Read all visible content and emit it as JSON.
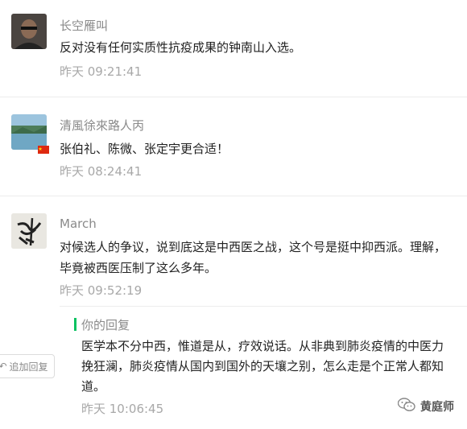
{
  "comments": [
    {
      "nickname": "长空雁叫",
      "content": "反对没有任何实质性抗疫成果的钟南山入选。",
      "time": "昨天 09:21:41",
      "avatar_icon": "bald-man-avatar"
    },
    {
      "nickname": "清風徐來路人丙",
      "content": "张伯礼、陈微、张定宇更合适！",
      "time": "昨天 08:24:41",
      "avatar_icon": "lake-landscape-avatar",
      "flag_icon": "china-flag-icon"
    },
    {
      "nickname": "March",
      "content": "对候选人的争议，说到底这是中西医之战，这个号是挺中抑西派。理解，毕竟被西医压制了这么多年。",
      "time": "昨天 09:52:19",
      "avatar_icon": "calligraphy-avatar"
    }
  ],
  "reply": {
    "label": "你的回复",
    "content": "医学本不分中西，惟道是从，疗效说话。从非典到肺炎疫情的中医力挽狂澜，肺炎疫情从国内到国外的天壤之别，怎么走是个正常人都知道。",
    "time": "昨天 10:06:45",
    "accent_color": "#07c160"
  },
  "add_reply_button": {
    "label": "追加回复"
  },
  "watermark": {
    "label": "黄庭师",
    "icon": "wechat-icon"
  }
}
